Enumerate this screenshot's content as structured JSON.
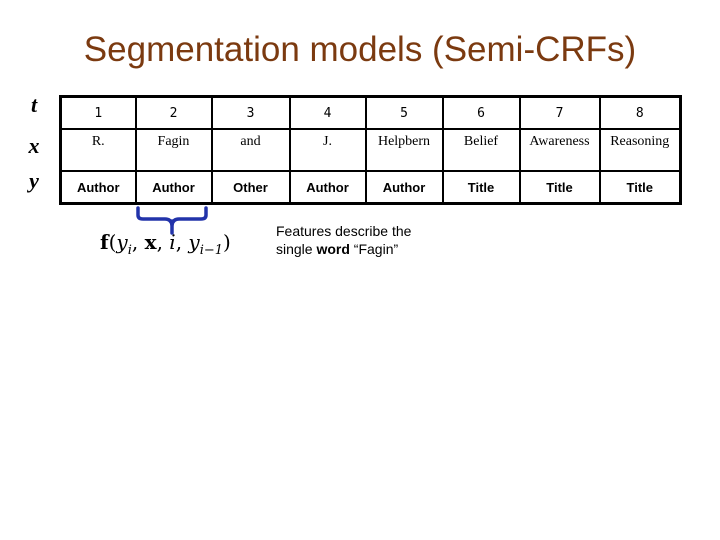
{
  "title": "Segmentation models (Semi-CRFs)",
  "row_labels": {
    "t": "t",
    "x": "x",
    "y": "y"
  },
  "table": {
    "t": [
      "1",
      "2",
      "3",
      "4",
      "5",
      "6",
      "7",
      "8"
    ],
    "x": [
      "R.",
      "Fagin",
      "and",
      "J.",
      "Helpbern",
      "Belief",
      "Awareness",
      "Reasoning"
    ],
    "y": [
      "Author",
      "Author",
      "Other",
      "Author",
      "Author",
      "Title",
      "Title",
      "Title"
    ]
  },
  "brace": {
    "color": "#2233aa",
    "covers_column": "2"
  },
  "formula": {
    "f": "f",
    "open": "(",
    "y": "y",
    "sub_i": "i",
    "comma1": ", ",
    "x": "x",
    "comma2": ", ",
    "i": "i",
    "comma3": ", ",
    "y2": "y",
    "sub_im1": "i−1",
    "close": ")"
  },
  "caption": {
    "line1": "Features describe the",
    "line2_pre": "single ",
    "line2_bold": "word",
    "line2_post": " “Fagin”"
  },
  "colors": {
    "title": "#7b3a10",
    "brace": "#2233aa"
  }
}
